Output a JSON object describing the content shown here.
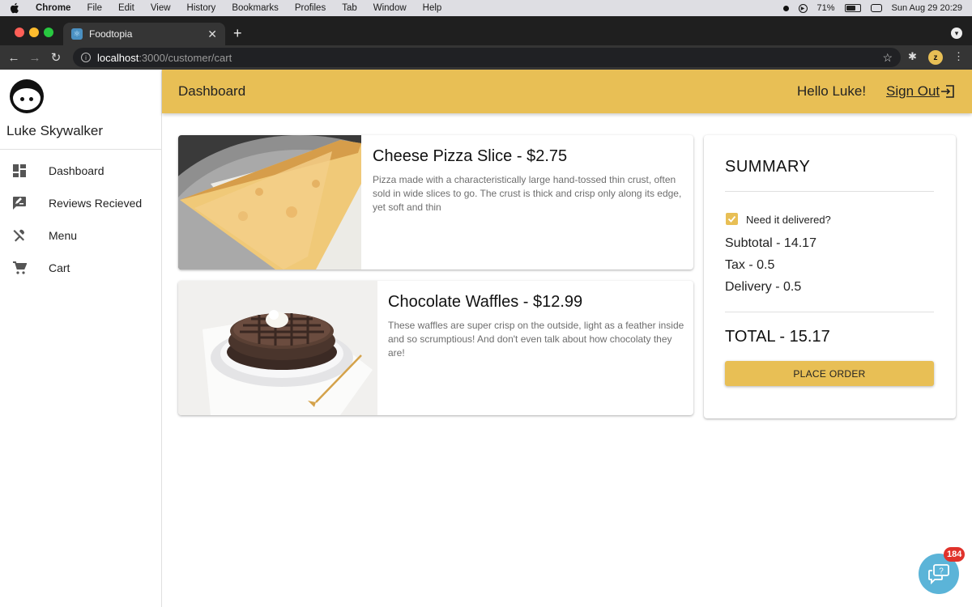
{
  "os": {
    "menu": [
      "Chrome",
      "File",
      "Edit",
      "View",
      "History",
      "Bookmarks",
      "Profiles",
      "Tab",
      "Window",
      "Help"
    ],
    "battery": "71%",
    "battery_level": 0.71,
    "clock": "Sun Aug 29  20:29"
  },
  "browser": {
    "tab_title": "Foodtopia",
    "url_host": "localhost",
    "url_rest": ":3000/customer/cart"
  },
  "sidebar": {
    "user_name": "Luke Skywalker",
    "items": [
      {
        "label": "Dashboard",
        "icon": "dashboard-icon"
      },
      {
        "label": "Reviews Recieved",
        "icon": "rate-review-icon"
      },
      {
        "label": "Menu",
        "icon": "restaurant-icon"
      },
      {
        "label": "Cart",
        "icon": "cart-icon"
      }
    ]
  },
  "header": {
    "title": "Dashboard",
    "greeting": "Hello Luke!",
    "sign_out": "Sign Out"
  },
  "cart": {
    "items": [
      {
        "title": "Cheese Pizza Slice - $2.75",
        "description": "Pizza made with a characteristically large hand-tossed thin crust, often sold in wide slices to go. The crust is thick and crisp only along its edge, yet soft and thin"
      },
      {
        "title": "Chocolate Waffles - $12.99",
        "description": "These waffles are super crisp on the outside, light as a feather inside and so scrumptious! And don't even talk about how chocolaty they are!"
      }
    ]
  },
  "summary": {
    "title": "SUMMARY",
    "delivery_checkbox": "Need it delivered?",
    "delivery_checked": true,
    "subtotal": "Subtotal - 14.17",
    "tax": "Tax - 0.5",
    "delivery": "Delivery - 0.5",
    "total": "TOTAL - 15.17",
    "place_order": "PLACE ORDER"
  },
  "chat": {
    "badge": "184"
  },
  "colors": {
    "accent": "#e8bf55",
    "chat": "#5bb4d8",
    "badge": "#e0322b"
  }
}
